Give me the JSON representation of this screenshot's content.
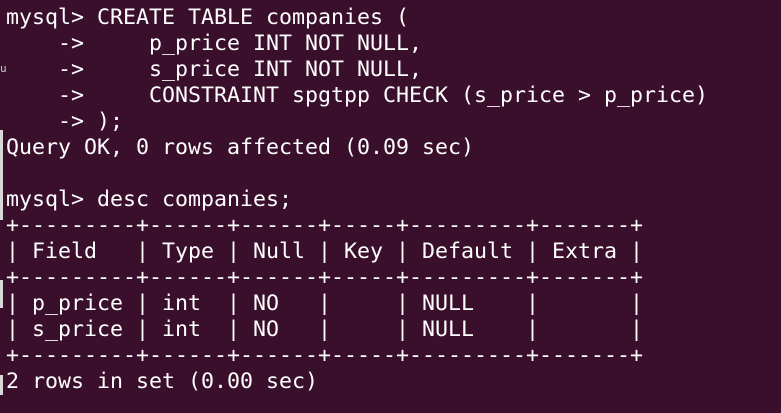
{
  "terminal": {
    "colors": {
      "background": "#3a0f2b",
      "foreground": "#ffffff"
    },
    "lines": [
      "mysql> CREATE TABLE companies (",
      "    ->     p_price INT NOT NULL,",
      "    ->     s_price INT NOT NULL,",
      "    ->     CONSTRAINT spgtpp CHECK (s_price > p_price)",
      "    -> );",
      "Query OK, 0 rows affected (0.09 sec)",
      "",
      "mysql> desc companies;",
      "+---------+------+------+-----+---------+-------+",
      "| Field   | Type | Null | Key | Default | Extra |",
      "+---------+------+------+-----+---------+-------+",
      "| p_price | int  | NO   |     | NULL    |       |",
      "| s_price | int  | NO   |     | NULL    |       |",
      "+---------+------+------+-----+---------+-------+",
      "2 rows in set (0.00 sec)"
    ]
  }
}
